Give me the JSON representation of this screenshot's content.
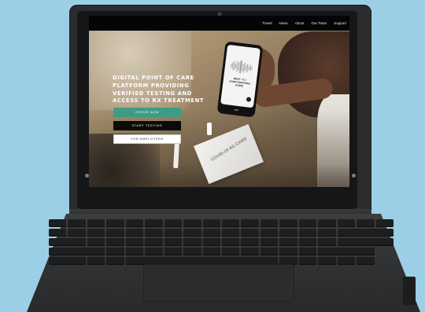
{
  "nav": {
    "items": [
      "Travel",
      "News",
      "About",
      "Our Team",
      "Support"
    ]
  },
  "hero": {
    "title": "DIGITAL POINT OF CARE PLATFORM PROVIDING VERIFIED TESTING AND ACCESS TO RX TREATMENT",
    "buttons": {
      "order": "ORDER NOW",
      "start": "START TESTING",
      "employers": "FOR EMPLOYERS"
    }
  },
  "phone": {
    "headline_prefix": "MEET",
    "headline_accent": "TAVI",
    "headline_rest": "YOUR CERTIFIED GUIDE",
    "logo": "cue"
  },
  "kit": {
    "label": "COVID-19 AG CARD"
  },
  "colors": {
    "accent": "#3e9c84",
    "background": "#9ccfe6",
    "laptop": "#2b2c2e"
  }
}
